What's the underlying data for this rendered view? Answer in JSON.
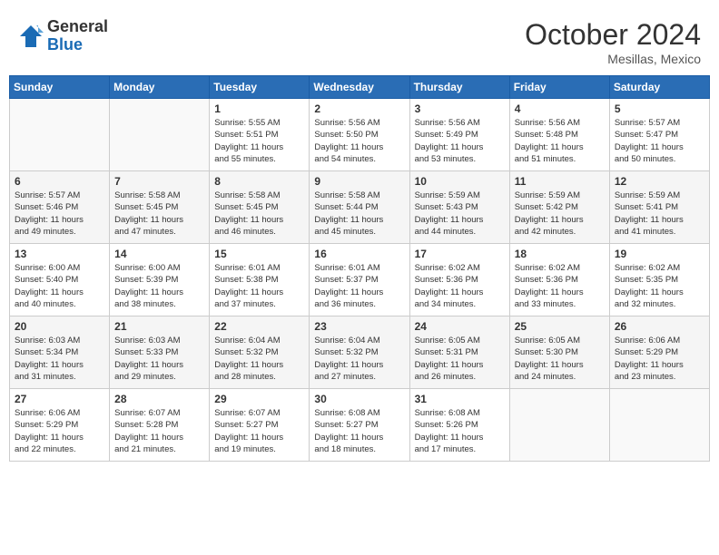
{
  "header": {
    "logo": {
      "general": "General",
      "blue": "Blue"
    },
    "title": "October 2024",
    "location": "Mesillas, Mexico"
  },
  "calendar": {
    "days_of_week": [
      "Sunday",
      "Monday",
      "Tuesday",
      "Wednesday",
      "Thursday",
      "Friday",
      "Saturday"
    ],
    "weeks": [
      [
        {
          "day": "",
          "info": ""
        },
        {
          "day": "",
          "info": ""
        },
        {
          "day": "1",
          "info": "Sunrise: 5:55 AM\nSunset: 5:51 PM\nDaylight: 11 hours\nand 55 minutes."
        },
        {
          "day": "2",
          "info": "Sunrise: 5:56 AM\nSunset: 5:50 PM\nDaylight: 11 hours\nand 54 minutes."
        },
        {
          "day": "3",
          "info": "Sunrise: 5:56 AM\nSunset: 5:49 PM\nDaylight: 11 hours\nand 53 minutes."
        },
        {
          "day": "4",
          "info": "Sunrise: 5:56 AM\nSunset: 5:48 PM\nDaylight: 11 hours\nand 51 minutes."
        },
        {
          "day": "5",
          "info": "Sunrise: 5:57 AM\nSunset: 5:47 PM\nDaylight: 11 hours\nand 50 minutes."
        }
      ],
      [
        {
          "day": "6",
          "info": "Sunrise: 5:57 AM\nSunset: 5:46 PM\nDaylight: 11 hours\nand 49 minutes."
        },
        {
          "day": "7",
          "info": "Sunrise: 5:58 AM\nSunset: 5:45 PM\nDaylight: 11 hours\nand 47 minutes."
        },
        {
          "day": "8",
          "info": "Sunrise: 5:58 AM\nSunset: 5:45 PM\nDaylight: 11 hours\nand 46 minutes."
        },
        {
          "day": "9",
          "info": "Sunrise: 5:58 AM\nSunset: 5:44 PM\nDaylight: 11 hours\nand 45 minutes."
        },
        {
          "day": "10",
          "info": "Sunrise: 5:59 AM\nSunset: 5:43 PM\nDaylight: 11 hours\nand 44 minutes."
        },
        {
          "day": "11",
          "info": "Sunrise: 5:59 AM\nSunset: 5:42 PM\nDaylight: 11 hours\nand 42 minutes."
        },
        {
          "day": "12",
          "info": "Sunrise: 5:59 AM\nSunset: 5:41 PM\nDaylight: 11 hours\nand 41 minutes."
        }
      ],
      [
        {
          "day": "13",
          "info": "Sunrise: 6:00 AM\nSunset: 5:40 PM\nDaylight: 11 hours\nand 40 minutes."
        },
        {
          "day": "14",
          "info": "Sunrise: 6:00 AM\nSunset: 5:39 PM\nDaylight: 11 hours\nand 38 minutes."
        },
        {
          "day": "15",
          "info": "Sunrise: 6:01 AM\nSunset: 5:38 PM\nDaylight: 11 hours\nand 37 minutes."
        },
        {
          "day": "16",
          "info": "Sunrise: 6:01 AM\nSunset: 5:37 PM\nDaylight: 11 hours\nand 36 minutes."
        },
        {
          "day": "17",
          "info": "Sunrise: 6:02 AM\nSunset: 5:36 PM\nDaylight: 11 hours\nand 34 minutes."
        },
        {
          "day": "18",
          "info": "Sunrise: 6:02 AM\nSunset: 5:36 PM\nDaylight: 11 hours\nand 33 minutes."
        },
        {
          "day": "19",
          "info": "Sunrise: 6:02 AM\nSunset: 5:35 PM\nDaylight: 11 hours\nand 32 minutes."
        }
      ],
      [
        {
          "day": "20",
          "info": "Sunrise: 6:03 AM\nSunset: 5:34 PM\nDaylight: 11 hours\nand 31 minutes."
        },
        {
          "day": "21",
          "info": "Sunrise: 6:03 AM\nSunset: 5:33 PM\nDaylight: 11 hours\nand 29 minutes."
        },
        {
          "day": "22",
          "info": "Sunrise: 6:04 AM\nSunset: 5:32 PM\nDaylight: 11 hours\nand 28 minutes."
        },
        {
          "day": "23",
          "info": "Sunrise: 6:04 AM\nSunset: 5:32 PM\nDaylight: 11 hours\nand 27 minutes."
        },
        {
          "day": "24",
          "info": "Sunrise: 6:05 AM\nSunset: 5:31 PM\nDaylight: 11 hours\nand 26 minutes."
        },
        {
          "day": "25",
          "info": "Sunrise: 6:05 AM\nSunset: 5:30 PM\nDaylight: 11 hours\nand 24 minutes."
        },
        {
          "day": "26",
          "info": "Sunrise: 6:06 AM\nSunset: 5:29 PM\nDaylight: 11 hours\nand 23 minutes."
        }
      ],
      [
        {
          "day": "27",
          "info": "Sunrise: 6:06 AM\nSunset: 5:29 PM\nDaylight: 11 hours\nand 22 minutes."
        },
        {
          "day": "28",
          "info": "Sunrise: 6:07 AM\nSunset: 5:28 PM\nDaylight: 11 hours\nand 21 minutes."
        },
        {
          "day": "29",
          "info": "Sunrise: 6:07 AM\nSunset: 5:27 PM\nDaylight: 11 hours\nand 19 minutes."
        },
        {
          "day": "30",
          "info": "Sunrise: 6:08 AM\nSunset: 5:27 PM\nDaylight: 11 hours\nand 18 minutes."
        },
        {
          "day": "31",
          "info": "Sunrise: 6:08 AM\nSunset: 5:26 PM\nDaylight: 11 hours\nand 17 minutes."
        },
        {
          "day": "",
          "info": ""
        },
        {
          "day": "",
          "info": ""
        }
      ]
    ]
  }
}
